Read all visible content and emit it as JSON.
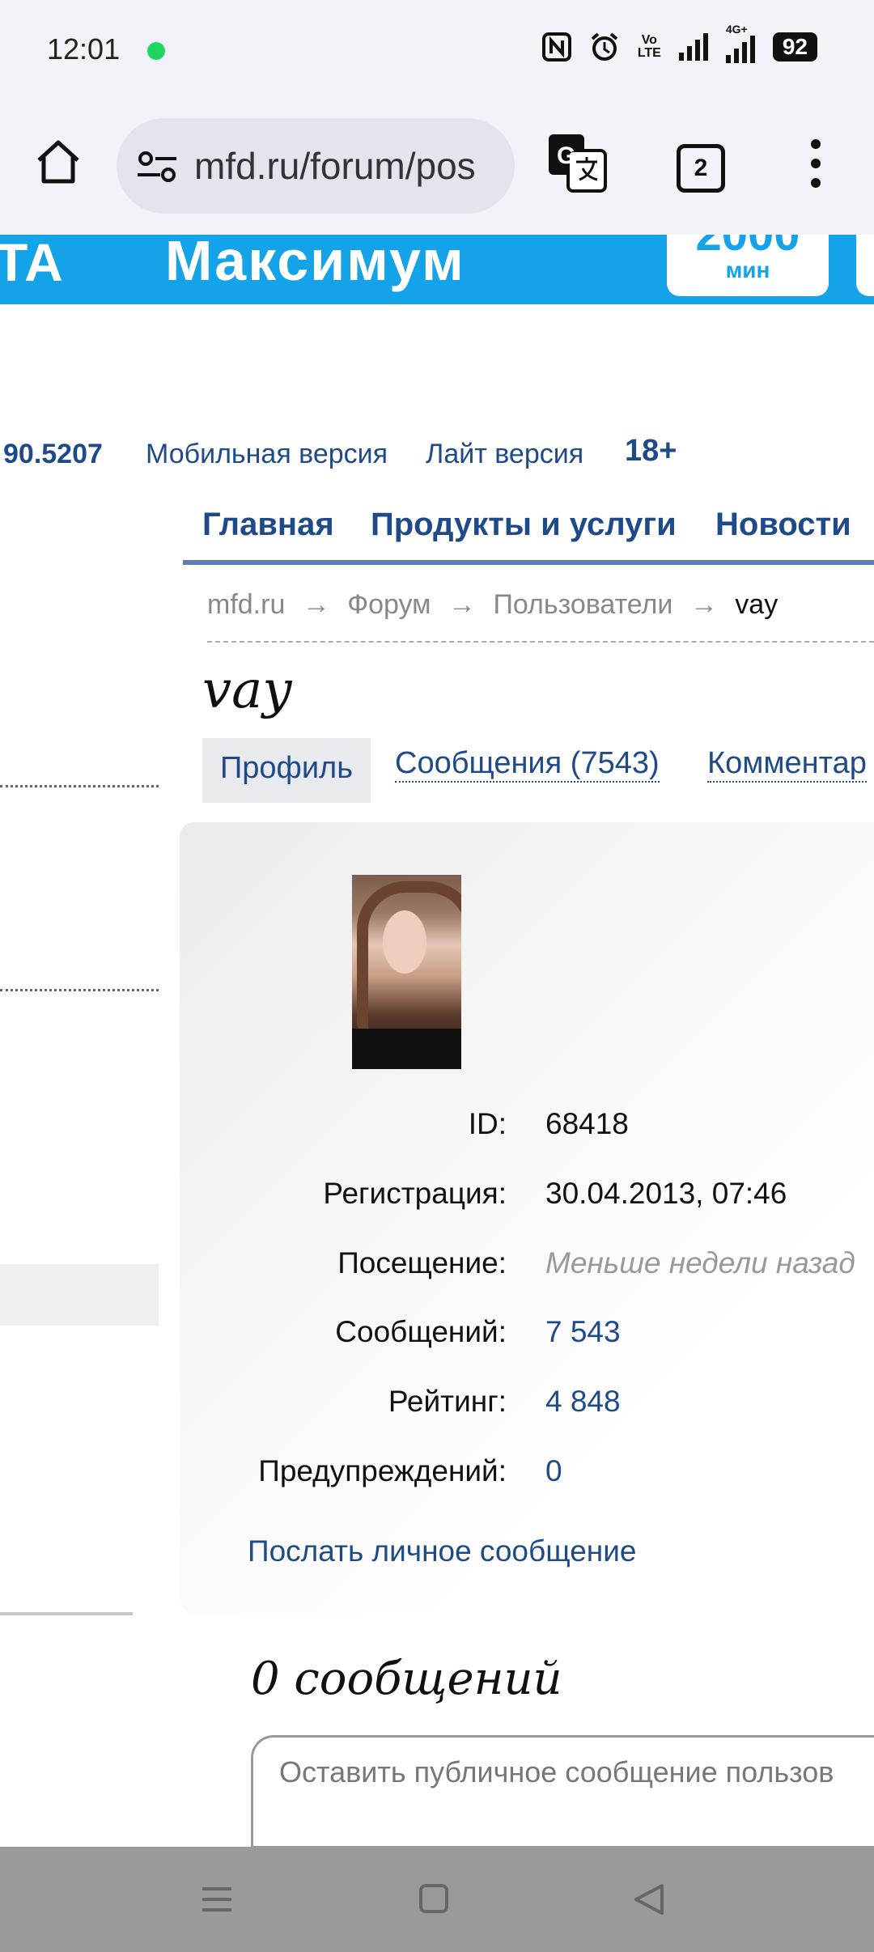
{
  "status_bar": {
    "time": "12:01",
    "battery": "92",
    "icons": [
      "spotify-dot-icon",
      "nfc-icon",
      "alarm-icon",
      "volte-icon",
      "signal-icon",
      "4g-signal-icon",
      "battery-icon"
    ],
    "volte_line1": "Vo",
    "volte_line2": "LTE",
    "network": "4G+"
  },
  "browser": {
    "url": "mfd.ru/forum/pos",
    "tab_count": "2"
  },
  "banner": {
    "text_left": "ТА",
    "text_main": "Максимум",
    "card_number": "2000",
    "card_unit": "мин",
    "color": "#14a3e8"
  },
  "top_links": {
    "quote_value": "90.5207",
    "mobile": "Мобильная версия",
    "lite": "Лайт версия",
    "age": "18+"
  },
  "nav": {
    "items": [
      "Главная",
      "Продукты и услуги",
      "Новости"
    ]
  },
  "breadcrumb": {
    "items": [
      "mfd.ru",
      "Форум",
      "Пользователи"
    ],
    "separator": "→",
    "current": "vay"
  },
  "profile": {
    "username": "vay",
    "tabs": [
      "Профиль",
      "Сообщения (7543)",
      "Комментар"
    ],
    "fields": [
      {
        "label": "ID:",
        "value": "68418",
        "style": "plain"
      },
      {
        "label": "Регистрация:",
        "value": "30.04.2013, 07:46",
        "style": "plain"
      },
      {
        "label": "Посещение:",
        "value": "Меньше недели назад",
        "style": "italic"
      },
      {
        "label": "Сообщений:",
        "value": "7 543",
        "style": "link"
      },
      {
        "label": "Рейтинг:",
        "value": "4 848",
        "style": "link"
      },
      {
        "label": "Предупреждений:",
        "value": "0",
        "style": "link"
      }
    ],
    "send_message": "Послать личное сообщение"
  },
  "wall": {
    "count_title": "0 сообщений",
    "placeholder": "Оставить публичное сообщение пользов"
  },
  "colors": {
    "link": "#1f4a8a",
    "accent_line": "#5f7bb0",
    "toolbar_bg": "#f1f3f8"
  }
}
